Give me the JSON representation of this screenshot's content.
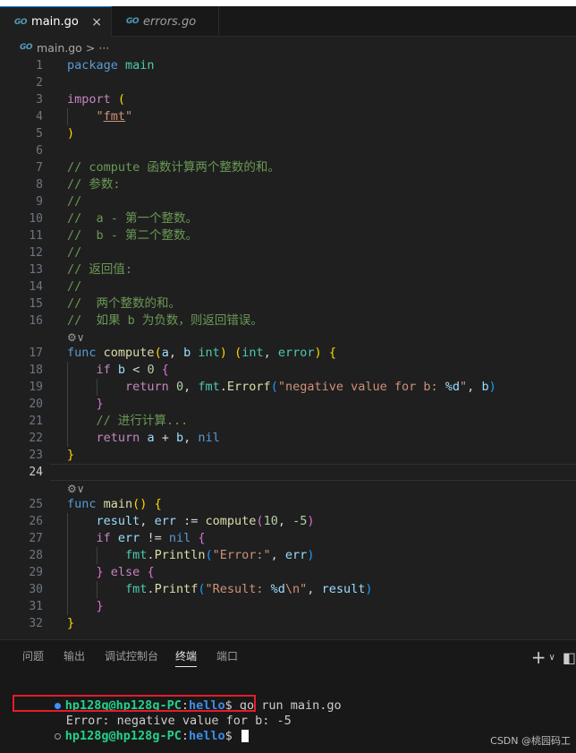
{
  "tabs": [
    {
      "icon": "GO",
      "label": "main.go",
      "close": "×"
    },
    {
      "icon": "GO",
      "label": "errors.go"
    }
  ],
  "breadcrumb": {
    "icon": "GO",
    "file": "main.go",
    "more": "> ···"
  },
  "codelens_icon": "⚙︎∨",
  "current_line": 24,
  "lines": [
    {
      "n": "1",
      "html": "<span class='kw'>package</span> <span class='ty'>main</span>"
    },
    {
      "n": "2",
      "html": ""
    },
    {
      "n": "3",
      "html": "<span class='kw2'>import</span> <span class='br1'>(</span>"
    },
    {
      "n": "4",
      "html": "    <span class='str'>\"<span class='ul'>fmt</span>\"</span>"
    },
    {
      "n": "5",
      "html": "<span class='br1'>)</span>"
    },
    {
      "n": "6",
      "html": ""
    },
    {
      "n": "7",
      "html": "<span class='cm'>// compute 函数计算两个整数的和。</span>"
    },
    {
      "n": "8",
      "html": "<span class='cm'>// 参数:</span>"
    },
    {
      "n": "9",
      "html": "<span class='cm'>//</span>"
    },
    {
      "n": "10",
      "html": "<span class='cm'>//  a - 第一个整数。</span>"
    },
    {
      "n": "11",
      "html": "<span class='cm'>//  b - 第二个整数。</span>"
    },
    {
      "n": "12",
      "html": "<span class='cm'>//</span>"
    },
    {
      "n": "13",
      "html": "<span class='cm'>// 返回值:</span>"
    },
    {
      "n": "14",
      "html": "<span class='cm'>//</span>"
    },
    {
      "n": "15",
      "html": "<span class='cm'>//  两个整数的和。</span>"
    },
    {
      "n": "16",
      "html": "<span class='cm'>//  如果 b 为负数，则返回错误。</span>"
    },
    {
      "n": "17",
      "html": "<span class='kw'>func</span> <span class='fn'>compute</span><span class='br1'>(</span><span class='var'>a</span><span class='pl'>,</span> <span class='var'>b</span> <span class='ty'>int</span><span class='br1'>)</span> <span class='br1'>(</span><span class='ty'>int</span><span class='pl'>,</span> <span class='ty'>error</span><span class='br1'>)</span> <span class='br1'>{</span>"
    },
    {
      "n": "18",
      "html": "    <span class='kw2'>if</span> <span class='var'>b</span> <span class='pl'>&lt;</span> <span class='num'>0</span> <span class='br2'>{</span>"
    },
    {
      "n": "19",
      "html": "        <span class='kw2'>return</span> <span class='num'>0</span><span class='pl'>,</span> <span class='ty'>fmt</span><span class='pl'>.</span><span class='fn'>Errorf</span><span class='br3'>(</span><span class='str'>\"negative value for b: </span><span class='var'>%d</span><span class='str'>\"</span><span class='pl'>,</span> <span class='var'>b</span><span class='br3'>)</span>"
    },
    {
      "n": "20",
      "html": "    <span class='br2'>}</span>"
    },
    {
      "n": "21",
      "html": "    <span class='cm'>// 进行计算...</span>"
    },
    {
      "n": "22",
      "html": "    <span class='kw2'>return</span> <span class='var'>a</span> <span class='pl'>+</span> <span class='var'>b</span><span class='pl'>,</span> <span class='kw'>nil</span>"
    },
    {
      "n": "23",
      "html": "<span class='br1'>}</span>"
    },
    {
      "n": "24",
      "html": ""
    },
    {
      "n": "25",
      "html": "<span class='kw'>func</span> <span class='fn'>main</span><span class='br1'>()</span> <span class='br1'>{</span>"
    },
    {
      "n": "26",
      "html": "    <span class='var'>result</span><span class='pl'>,</span> <span class='var'>err</span> <span class='pl'>:=</span> <span class='fn'>compute</span><span class='br2'>(</span><span class='num'>10</span><span class='pl'>,</span> <span class='num'>-5</span><span class='br2'>)</span>"
    },
    {
      "n": "27",
      "html": "    <span class='kw2'>if</span> <span class='var'>err</span> <span class='pl'>!=</span> <span class='kw'>nil</span> <span class='br2'>{</span>"
    },
    {
      "n": "28",
      "html": "        <span class='ty'>fmt</span><span class='pl'>.</span><span class='fn'>Println</span><span class='br3'>(</span><span class='str'>\"Error:\"</span><span class='pl'>,</span> <span class='var'>err</span><span class='br3'>)</span>"
    },
    {
      "n": "29",
      "html": "    <span class='br2'>}</span> <span class='kw2'>else</span> <span class='br2'>{</span>"
    },
    {
      "n": "30",
      "html": "        <span class='ty'>fmt</span><span class='pl'>.</span><span class='fn'>Printf</span><span class='br3'>(</span><span class='str'>\"Result: </span><span class='var'>%d</span><span class='str'>\\n\"</span><span class='pl'>,</span> <span class='var'>result</span><span class='br3'>)</span>"
    },
    {
      "n": "31",
      "html": "    <span class='br2'>}</span>"
    },
    {
      "n": "32",
      "html": "<span class='br1'>}</span>"
    }
  ],
  "panel": {
    "tabs": [
      "问题",
      "输出",
      "调试控制台",
      "终端",
      "端口"
    ],
    "active_tab": "终端",
    "actions": {
      "add": "+",
      "chevron": "∨",
      "layout": "◧"
    }
  },
  "terminal": {
    "prompt_user": "hp128g@hp128g-PC",
    "prompt_dir": "hello",
    "prompt_sign": "$",
    "command": " go run main.go",
    "output": "Error: negative value for b: -5"
  },
  "colors": {
    "error_highlight": "#e51c2b",
    "accent": "#0078d4"
  },
  "watermark": "CSDN @桃园码工"
}
